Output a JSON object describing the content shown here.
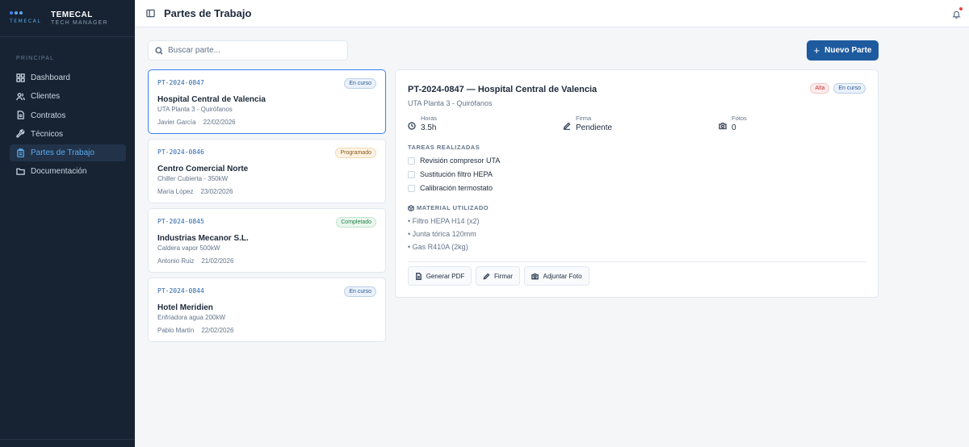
{
  "brand": {
    "logo_word": "TEMECAL",
    "name": "TEMECAL",
    "subtitle": "TECH MANAGER"
  },
  "sidebar": {
    "section_label": "PRINCIPAL",
    "items": [
      {
        "label": "Dashboard",
        "icon": "grid-icon"
      },
      {
        "label": "Clientes",
        "icon": "users-icon"
      },
      {
        "label": "Contratos",
        "icon": "file-icon"
      },
      {
        "label": "Técnicos",
        "icon": "wrench-icon"
      },
      {
        "label": "Partes de Trabajo",
        "icon": "clipboard-icon",
        "active": true
      },
      {
        "label": "Documentación",
        "icon": "folder-icon"
      }
    ]
  },
  "header": {
    "title": "Partes de Trabajo",
    "notification_dot_color": "#ef4444"
  },
  "search": {
    "placeholder": "Buscar parte...",
    "value": ""
  },
  "new_button": {
    "label": "Nuevo Parte"
  },
  "cards": [
    {
      "code": "PT-2024-0847",
      "status": "En curso",
      "title": "Hospital Central de Valencia",
      "subtitle": "UTA Planta 3 - Quirófanos",
      "technician": "Javier García",
      "date": "22/02/2026",
      "selected": true
    },
    {
      "code": "PT-2024-0846",
      "status": "Programado",
      "title": "Centro Comercial Norte",
      "subtitle": "Chiller Cubierta - 350kW",
      "technician": "María López",
      "date": "23/02/2026"
    },
    {
      "code": "PT-2024-0845",
      "status": "Completado",
      "title": "Industrias Mecanor S.L.",
      "subtitle": "Caldera vapor 500kW",
      "technician": "Antonio Ruiz",
      "date": "21/02/2026"
    },
    {
      "code": "PT-2024-0844",
      "status": "En curso",
      "title": "Hotel Meridien",
      "subtitle": "Enfriadora agua 200kW",
      "technician": "Pablo Martín",
      "date": "22/02/2026"
    }
  ],
  "detail": {
    "title": "PT-2024-0847 — Hospital Central de Valencia",
    "subtitle": "UTA Planta 3 - Quirófanos",
    "priority_badge": "Alta",
    "status_badge": "En curso",
    "stats": [
      {
        "label": "Horas",
        "value": "3.5h",
        "icon": "clock-icon"
      },
      {
        "label": "Firma",
        "value": "Pendiente",
        "icon": "signature-icon"
      },
      {
        "label": "Fotos",
        "value": "0",
        "icon": "camera-icon"
      }
    ],
    "tasks_heading": "TAREAS REALIZADAS",
    "tasks": [
      "Revisión compresor UTA",
      "Sustitución filtro HEPA",
      "Calibración termostato"
    ],
    "materials_heading": "MATERIAL UTILIZADO",
    "materials": [
      "• Filtro HEPA H14 (x2)",
      "• Junta tórica 120mm",
      "• Gas R410A (2kg)"
    ],
    "actions": [
      {
        "label": "Generar PDF",
        "icon": "file-pdf-icon"
      },
      {
        "label": "Firmar",
        "icon": "signature-icon"
      },
      {
        "label": "Adjuntar Foto",
        "icon": "camera-icon"
      }
    ]
  },
  "colors": {
    "sidebar_bg": "#172333",
    "accent": "#1e5a9e",
    "link": "#2563a8",
    "active_nav": "#5aa9ec"
  }
}
